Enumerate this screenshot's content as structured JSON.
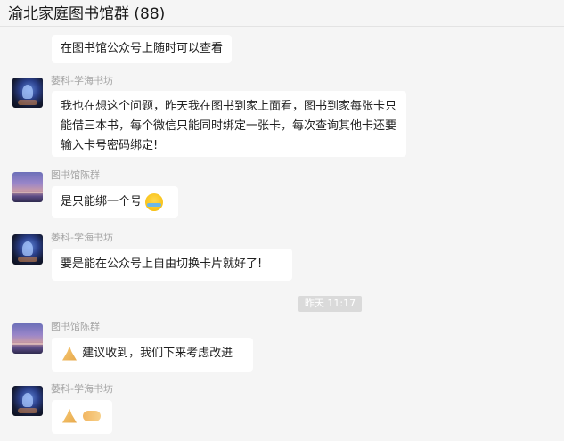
{
  "header": {
    "title": "渝北家庭图书馆群 (88)"
  },
  "messages": [
    {
      "sender": "",
      "text": "在图书馆公众号上随时可以查看"
    },
    {
      "sender": "萎科-学海书坊",
      "text": "我也在想这个问题，昨天我在图书到家上面看，图书到家每张卡只能借三本书，每个微信只能同时绑定一张卡，每次查询其他卡还要输入卡号密码绑定!"
    },
    {
      "sender": "图书馆陈群",
      "text": "是只能绑一个号"
    },
    {
      "sender": "萎科-学海书坊",
      "text": "要是能在公众号上自由切换卡片就好了!"
    },
    {
      "sender": "图书馆陈群",
      "text": "建议收到，我们下来考虑改进"
    },
    {
      "sender": "萎科-学海书坊",
      "text": ""
    }
  ],
  "time_divider": {
    "text": "昨天 11:17"
  },
  "avatars": [
    {
      "icon": "library-sunset-avatar"
    },
    {
      "icon": "ship-avatar"
    },
    {
      "icon": "library-sunset-avatar"
    },
    {
      "icon": "ship-avatar"
    },
    {
      "icon": "library-sunset-avatar"
    },
    {
      "icon": "ship-avatar"
    }
  ],
  "emoji": {
    "laugh_cry": "laugh-cry-emoji",
    "pray": "pray-emoji",
    "handshake": "handshake-emoji"
  },
  "colors": {
    "background": "#f5f5f5",
    "bubble": "#ffffff",
    "sender": "#a5a5a5",
    "time_badge": "#dadada"
  }
}
